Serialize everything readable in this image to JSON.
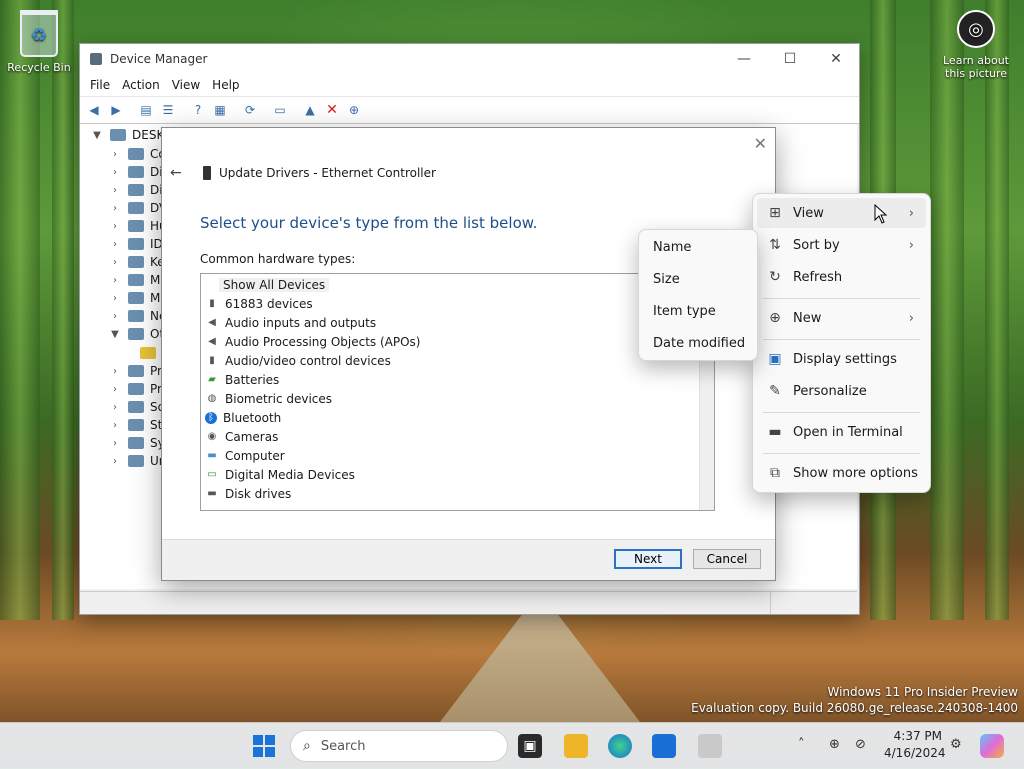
{
  "desktop": {
    "recycle_bin": "Recycle Bin",
    "learn_line1": "Learn about",
    "learn_line2": "this picture",
    "watermark_line1": "Windows 11 Pro Insider Preview",
    "watermark_line2": "Evaluation copy. Build 26080.ge_release.240308-1400"
  },
  "device_manager": {
    "title": "Device Manager",
    "menu": [
      "File",
      "Action",
      "View",
      "Help"
    ],
    "root": "DESKTC",
    "tree": [
      "Cor",
      "Disk",
      "Disp",
      "DVD",
      "Hum",
      "IDE",
      "Key",
      "Mic",
      "Mo",
      "Net",
      "Oth",
      "",
      "Prin",
      "Pro",
      "Soft",
      "Stor",
      "Syst",
      "Uni"
    ]
  },
  "dialog": {
    "header": "Update Drivers - Ethernet Controller",
    "instruction": "Select your device's type from the list below.",
    "list_label": "Common hardware types:",
    "items": [
      "Show All Devices",
      "61883 devices",
      "Audio inputs and outputs",
      "Audio Processing Objects (APOs)",
      "Audio/video control devices",
      "Batteries",
      "Biometric devices",
      "Bluetooth",
      "Cameras",
      "Computer",
      "Digital Media Devices",
      "Disk drives"
    ],
    "next": "Next",
    "cancel": "Cancel"
  },
  "context_menu": {
    "items": [
      {
        "label": "View",
        "icon": "grid-icon"
      },
      {
        "label": "Sort by",
        "icon": "sort-icon"
      },
      {
        "label": "Refresh",
        "icon": "refresh-icon"
      },
      {
        "label": "New",
        "icon": "plus-circle-icon"
      },
      {
        "label": "Display settings",
        "icon": "display-icon"
      },
      {
        "label": "Personalize",
        "icon": "pen-icon"
      },
      {
        "label": "Open in Terminal",
        "icon": "terminal-icon"
      },
      {
        "label": "Show more options",
        "icon": "share-icon"
      }
    ]
  },
  "sort_submenu": {
    "items": [
      "Name",
      "Size",
      "Item type",
      "Date modified"
    ]
  },
  "taskbar": {
    "search_placeholder": "Search",
    "time": "4:37 PM",
    "date": "4/16/2024"
  }
}
